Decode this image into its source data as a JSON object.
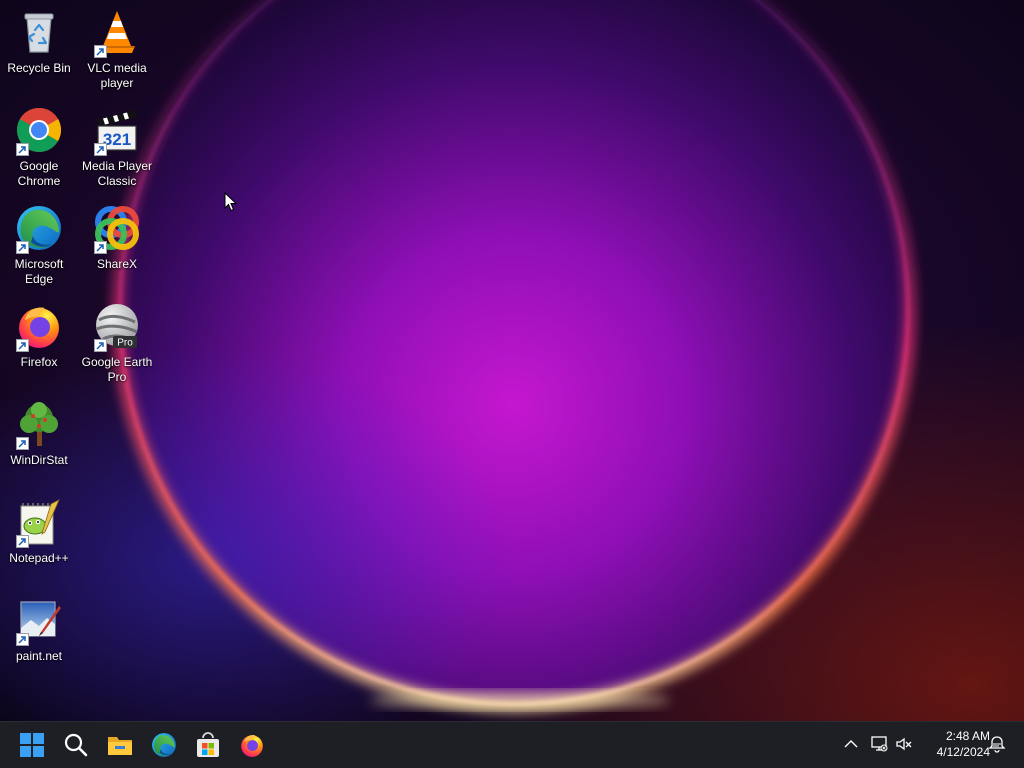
{
  "desktop": {
    "icons": [
      {
        "label": "Recycle Bin",
        "icon": "recycle-bin-icon",
        "shortcut": false
      },
      {
        "label": "VLC media player",
        "icon": "vlc-icon",
        "shortcut": true
      },
      {
        "label": "Google Chrome",
        "icon": "chrome-icon",
        "shortcut": true
      },
      {
        "label": "Media Player Classic",
        "icon": "media-player-classic-icon",
        "shortcut": true
      },
      {
        "label": "Microsoft Edge",
        "icon": "edge-icon",
        "shortcut": true
      },
      {
        "label": "ShareX",
        "icon": "sharex-icon",
        "shortcut": true
      },
      {
        "label": "Firefox",
        "icon": "firefox-icon",
        "shortcut": true
      },
      {
        "label": "Google Earth Pro",
        "icon": "google-earth-pro-icon",
        "shortcut": true,
        "badge": "Pro"
      },
      {
        "label": "WinDirStat",
        "icon": "windirstat-icon",
        "shortcut": true
      },
      {
        "label": "Notepad++",
        "icon": "notepadpp-icon",
        "shortcut": true
      },
      {
        "label": "paint.net",
        "icon": "paintnet-icon",
        "shortcut": true
      }
    ],
    "mpc_badge": "321"
  },
  "taskbar": {
    "pinned": [
      {
        "name": "start",
        "icon": "windows-start-icon"
      },
      {
        "name": "search",
        "icon": "search-icon"
      },
      {
        "name": "file-explorer",
        "icon": "folder-icon"
      },
      {
        "name": "edge",
        "icon": "edge-icon"
      },
      {
        "name": "microsoft-store",
        "icon": "store-icon"
      },
      {
        "name": "firefox",
        "icon": "firefox-icon"
      }
    ],
    "tray": [
      {
        "name": "show-hidden-icons",
        "icon": "chevron-up-icon"
      },
      {
        "name": "network",
        "icon": "network-icon"
      },
      {
        "name": "volume",
        "icon": "speaker-muted-icon"
      }
    ],
    "clock": {
      "time": "2:48 AM",
      "date": "4/12/2024"
    },
    "notifications": {
      "icon": "notification-bell-icon"
    }
  },
  "colors": {
    "taskbar_bg": "#1e1f24",
    "wallpaper_glow": "#b412c8",
    "wallpaper_rim": "#ff5a3c",
    "start_blue": "#3aa0f3"
  }
}
